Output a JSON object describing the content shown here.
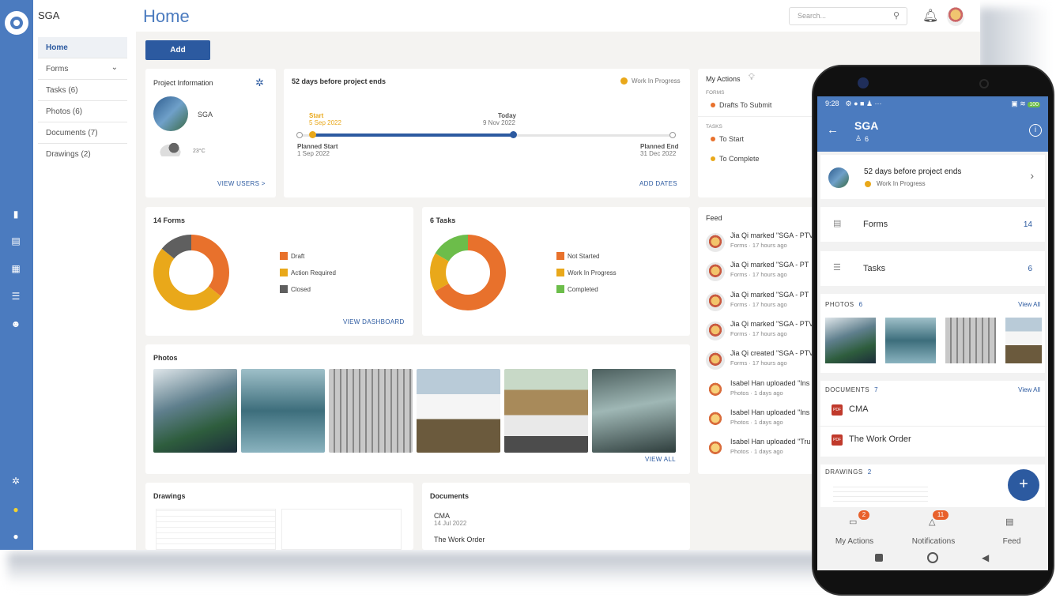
{
  "app": {
    "project": "SGA",
    "page_title": "Home"
  },
  "search": {
    "placeholder": "Search..."
  },
  "sidebar": {
    "items": [
      {
        "label": "Home",
        "active": true
      },
      {
        "label": "Forms",
        "chevron": true
      },
      {
        "label": "Tasks (6)"
      },
      {
        "label": "Photos (6)"
      },
      {
        "label": "Documents (7)"
      },
      {
        "label": "Drawings (2)"
      }
    ]
  },
  "rail_icons": [
    "briefcase-icon",
    "document-icon",
    "calendar-icon",
    "checklist-icon",
    "people-icon",
    "gear-icon",
    "help-icon",
    "info-icon"
  ],
  "toolbar": {
    "add_label": "Add"
  },
  "project_info": {
    "title": "Project Information",
    "name": "SGA",
    "temp": "23°C",
    "view_users": "VIEW USERS >"
  },
  "timeline": {
    "title": "52 days before project ends",
    "status": "Work In Progress",
    "start_label": "Start",
    "start_date": "5 Sep 2022",
    "today_label": "Today",
    "today_date": "9 Nov 2022",
    "planned_start_label": "Planned Start",
    "planned_start_date": "1 Sep 2022",
    "planned_end_label": "Planned End",
    "planned_end_date": "31 Dec 2022",
    "add_dates": "ADD DATES"
  },
  "my_actions": {
    "title": "My Actions",
    "forms_label": "FORMS",
    "drafts": "Drafts To Submit",
    "tasks_label": "TASKS",
    "to_start": "To Start",
    "to_complete": "To Complete"
  },
  "forms_card": {
    "title": "14 Forms",
    "view_dashboard": "VIEW DASHBOARD"
  },
  "tasks_card": {
    "title": "6 Tasks"
  },
  "chart_data": [
    {
      "type": "pie",
      "title": "14 Forms",
      "categories": [
        "Draft",
        "Action Required",
        "Closed"
      ],
      "values": [
        5,
        7,
        2
      ],
      "colors": [
        "#e8712c",
        "#e9a81a",
        "#5f5f5f"
      ]
    },
    {
      "type": "pie",
      "title": "6 Tasks",
      "categories": [
        "Not Started",
        "Work In Progress",
        "Completed"
      ],
      "values": [
        4,
        1,
        1
      ],
      "colors": [
        "#e8712c",
        "#e9a81a",
        "#6cbd4a"
      ]
    }
  ],
  "photos_card": {
    "title": "Photos",
    "view_all": "VIEW ALL"
  },
  "drawings_card": {
    "title": "Drawings"
  },
  "documents_card": {
    "title": "Documents",
    "docs": [
      {
        "name": "CMA",
        "date": "14 Jul 2022"
      },
      {
        "name": "The Work Order",
        "date": ""
      }
    ]
  },
  "feed": {
    "title": "Feed",
    "items": [
      {
        "text": "Jia Qi marked \"SGA - PTV",
        "sub": "Forms · 17 hours ago"
      },
      {
        "text": "Jia Qi marked \"SGA - PT",
        "sub": "Forms · 17 hours ago"
      },
      {
        "text": "Jia Qi marked \"SGA - PT",
        "sub": "Forms · 17 hours ago"
      },
      {
        "text": "Jia Qi marked \"SGA - PTV",
        "sub": "Forms · 17 hours ago"
      },
      {
        "text": "Jia Qi created \"SGA - PTV",
        "sub": "Forms · 17 hours ago"
      },
      {
        "text": "Isabel Han uploaded \"Ins",
        "sub": "Photos · 1 days ago"
      },
      {
        "text": "Isabel Han uploaded \"Ins",
        "sub": "Photos · 1 days ago"
      },
      {
        "text": "Isabel Han uploaded \"Tru",
        "sub": "Photos · 1 days ago"
      }
    ]
  },
  "phone": {
    "time": "9:28",
    "title": "SGA",
    "members": "6",
    "days": "52 days before project ends",
    "status": "Work In Progress",
    "forms_label": "Forms",
    "forms_count": "14",
    "tasks_label": "Tasks",
    "tasks_count": "6",
    "photos_label": "PHOTOS",
    "photos_count": "6",
    "view_all": "View All",
    "documents_label": "DOCUMENTS",
    "documents_count": "7",
    "doc1": "CMA",
    "doc2": "The Work Order",
    "drawings_label": "DRAWINGS",
    "drawings_count": "2",
    "nav": [
      {
        "label": "My Actions",
        "badge": "2"
      },
      {
        "label": "Notifications",
        "badge": "11"
      },
      {
        "label": "Feed",
        "badge": ""
      }
    ],
    "battery": "100"
  }
}
